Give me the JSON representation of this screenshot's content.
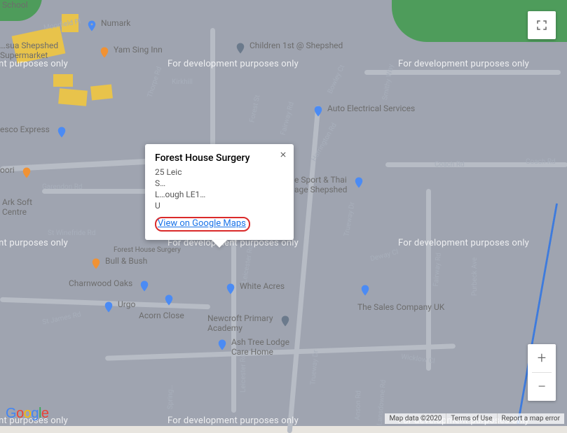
{
  "watermark_text": "For development purposes only",
  "info": {
    "title": "Forest House Surgery",
    "addr1": "25 Leic",
    "addr2": "S…",
    "addr3": "L…ough LE1…",
    "addr4": "U",
    "link_label": "View on Google Maps"
  },
  "controls": {
    "fullscreen_tooltip": "Toggle fullscreen view",
    "zoom_in": "+",
    "zoom_out": "−"
  },
  "attrib": {
    "data": "Map data ©2020",
    "terms": "Terms of Use",
    "report": "Report a map error"
  },
  "pois": {
    "school": "School",
    "numark": "Numark",
    "yamsing": "Yam Sing Inn",
    "children1st": "Children 1st @ Shepshed",
    "moorfield": "Moorfield Pl",
    "shepshed_super": "…sua Shepshed\nSupermarket",
    "kirkhill": "Kirkhill",
    "autoelec": "Auto Electrical Services",
    "tesco": "esco Express",
    "oori": "oori",
    "garendon": "Garendon Rd",
    "arksoft": "Ark Soft\nCentre",
    "winefride": "St Winefride Rd",
    "fhs_tiny": "Forest House Surgery",
    "bullbush": "Bull & Bush",
    "charnwood": "Charnwood Oaks",
    "urgo": "Urgo",
    "acorn": "Acorn Close",
    "whiteacres": "White Acres",
    "newcroft": "Newcroft Primary\nAcademy",
    "ashtree": "Ash Tree Lodge\nCare Home",
    "sport_thai": "e Sport & Thai\nage Shepshed",
    "sales": "The Sales Company UK",
    "coach": "Coach Rd",
    "stjames": "St James Rd",
    "leicester": "Leicester Rd",
    "trueway": "Trueway Dr",
    "wicklow": "Wicklow Cl",
    "purbeck": "Purbeck Ave",
    "fairway": "Fairway Rd",
    "harrington": "Harrington Rd",
    "smithy": "Smithy Way",
    "thorpe": "Thorpe Rd",
    "forestst": "Forest St",
    "bowley": "Bowley Ct",
    "deway": "Deway Cl",
    "spring": "Spring…",
    "anson": "Anson Rd",
    "lansdowne": "Lansdowne Rd"
  },
  "logo": [
    "G",
    "o",
    "o",
    "g",
    "l",
    "e"
  ]
}
